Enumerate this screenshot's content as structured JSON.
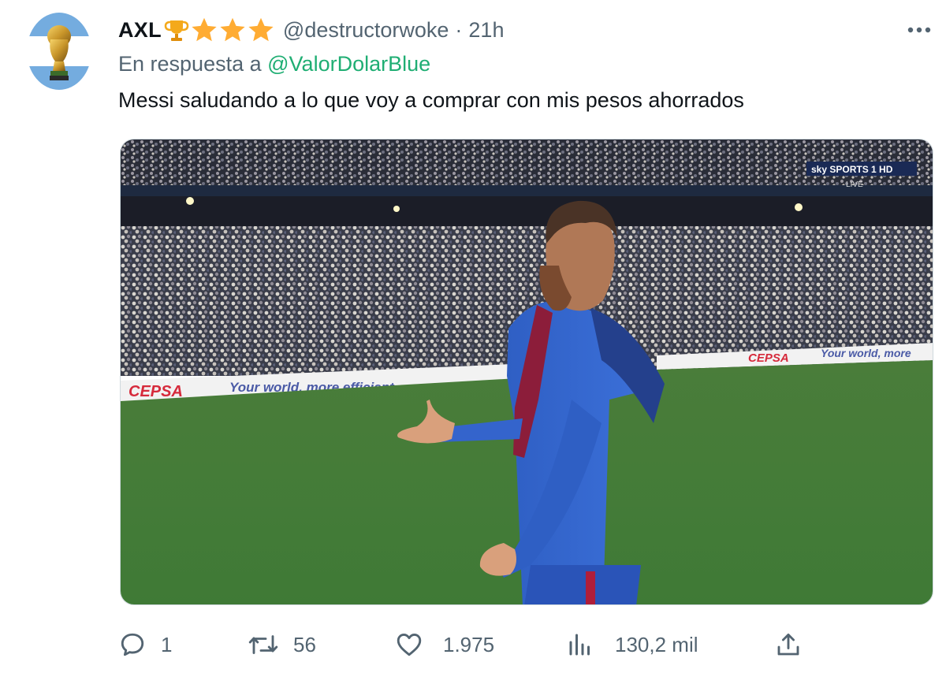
{
  "author": {
    "display_name": "AXL",
    "badges": [
      "trophy-emoji",
      "star-emoji",
      "star-emoji",
      "star-emoji"
    ],
    "handle": "@destructorwoke",
    "separator": "·",
    "time": "21h",
    "avatar_icon": "world-cup-trophy-icon"
  },
  "reply": {
    "prefix": "En respuesta a",
    "handle": "@ValorDolarBlue"
  },
  "text": "Messi saludando a lo que voy a comprar con mis pesos ahorrados",
  "media": {
    "description_icon": "football-player-photo",
    "broadcaster": "sky SPORTS 1 HD",
    "broadcaster_sub": "LIVE",
    "ad_brand": "CEPSA",
    "ad_slogan": "Your world, more efficient.",
    "ad_slogan_right": "Your world, more"
  },
  "actions": {
    "replies": "1",
    "retweets": "56",
    "likes": "1.975",
    "views": "130,2 mil"
  },
  "colors": {
    "text": "#0f1419",
    "secondary": "#536471",
    "link": "#1fae73"
  }
}
